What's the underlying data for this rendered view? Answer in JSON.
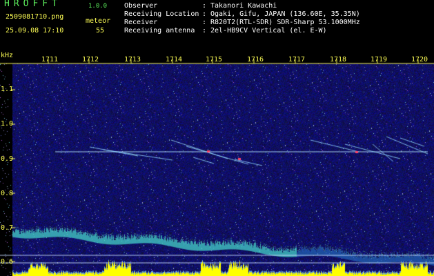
{
  "header": {
    "app_title": "HROFFT",
    "app_version": "1.0.0",
    "file_name": "2509081710.png",
    "date_time": "25.09.08 17:10",
    "event_type": "meteor",
    "event_count": "55",
    "info": [
      {
        "label": "Observer",
        "value": "Takanori Kawachi"
      },
      {
        "label": "Receiving Location",
        "value": "Ogaki, Gifu, JAPAN (136.60E, 35.35N)"
      },
      {
        "label": "Receiver",
        "value": "R820T2(RTL-SDR) SDR-Sharp 53.1000MHz"
      },
      {
        "label": "Receiving antenna",
        "value": "2el-HB9CV Vertical (el. E-W)"
      }
    ]
  },
  "axes": {
    "unit": "kHz",
    "time_ticks": [
      "1711",
      "1712",
      "1713",
      "1714",
      "1715",
      "1716",
      "1717",
      "1718",
      "1719",
      "1720"
    ],
    "freq_ticks": [
      "1.1",
      "1.0",
      "0.9",
      "0.8",
      "0.7",
      "0.6"
    ]
  },
  "colors": {
    "background": "#000000",
    "noise_base": "#0a0a6e",
    "header_green": "#5ef05e",
    "header_yellow": "#ffff55",
    "tick_yellow": "#ffff55",
    "signal_level": "#ffff00"
  }
}
